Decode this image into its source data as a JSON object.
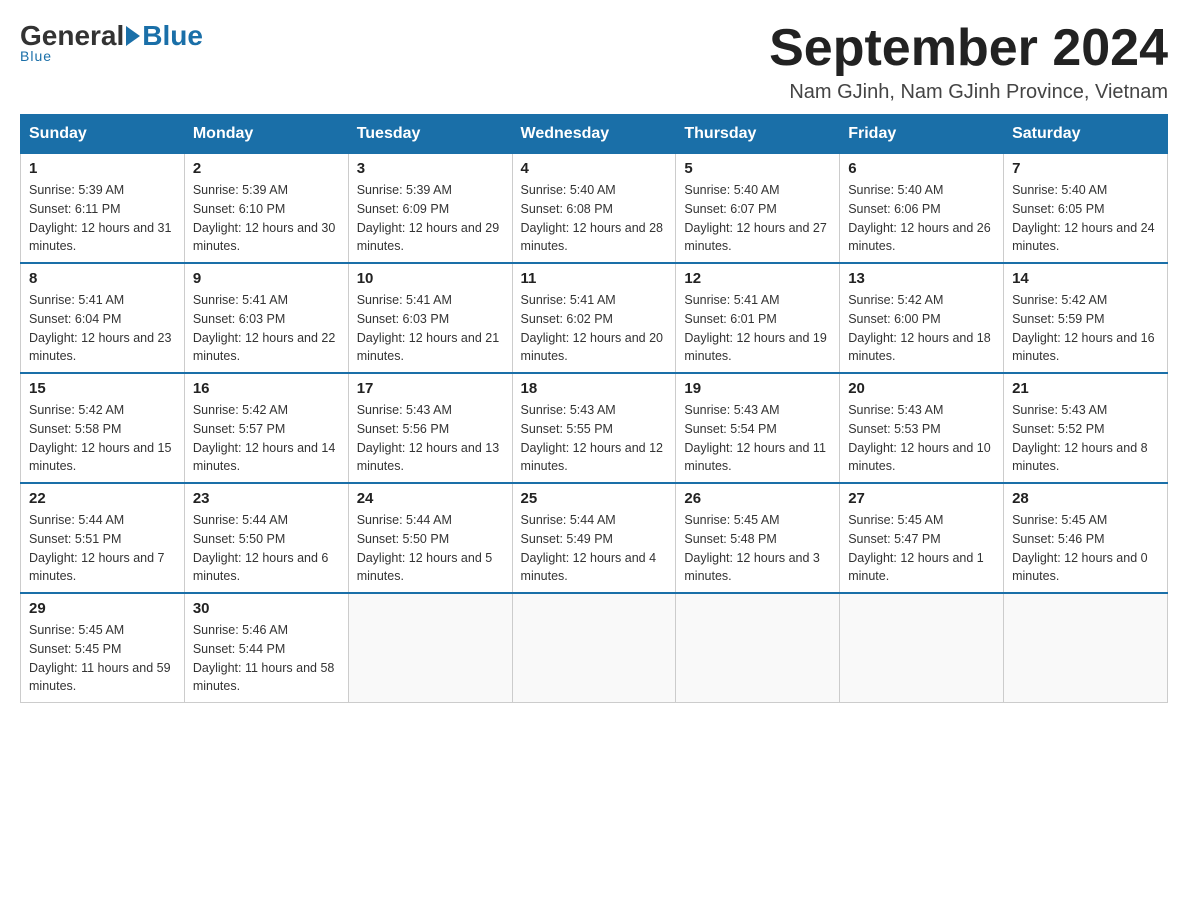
{
  "logo": {
    "general": "General",
    "blue": "Blue",
    "underline": "Blue"
  },
  "header": {
    "month_title": "September 2024",
    "subtitle": "Nam GJinh, Nam GJinh Province, Vietnam"
  },
  "weekdays": [
    "Sunday",
    "Monday",
    "Tuesday",
    "Wednesday",
    "Thursday",
    "Friday",
    "Saturday"
  ],
  "weeks": [
    [
      {
        "day": "1",
        "sunrise": "Sunrise: 5:39 AM",
        "sunset": "Sunset: 6:11 PM",
        "daylight": "Daylight: 12 hours and 31 minutes."
      },
      {
        "day": "2",
        "sunrise": "Sunrise: 5:39 AM",
        "sunset": "Sunset: 6:10 PM",
        "daylight": "Daylight: 12 hours and 30 minutes."
      },
      {
        "day": "3",
        "sunrise": "Sunrise: 5:39 AM",
        "sunset": "Sunset: 6:09 PM",
        "daylight": "Daylight: 12 hours and 29 minutes."
      },
      {
        "day": "4",
        "sunrise": "Sunrise: 5:40 AM",
        "sunset": "Sunset: 6:08 PM",
        "daylight": "Daylight: 12 hours and 28 minutes."
      },
      {
        "day": "5",
        "sunrise": "Sunrise: 5:40 AM",
        "sunset": "Sunset: 6:07 PM",
        "daylight": "Daylight: 12 hours and 27 minutes."
      },
      {
        "day": "6",
        "sunrise": "Sunrise: 5:40 AM",
        "sunset": "Sunset: 6:06 PM",
        "daylight": "Daylight: 12 hours and 26 minutes."
      },
      {
        "day": "7",
        "sunrise": "Sunrise: 5:40 AM",
        "sunset": "Sunset: 6:05 PM",
        "daylight": "Daylight: 12 hours and 24 minutes."
      }
    ],
    [
      {
        "day": "8",
        "sunrise": "Sunrise: 5:41 AM",
        "sunset": "Sunset: 6:04 PM",
        "daylight": "Daylight: 12 hours and 23 minutes."
      },
      {
        "day": "9",
        "sunrise": "Sunrise: 5:41 AM",
        "sunset": "Sunset: 6:03 PM",
        "daylight": "Daylight: 12 hours and 22 minutes."
      },
      {
        "day": "10",
        "sunrise": "Sunrise: 5:41 AM",
        "sunset": "Sunset: 6:03 PM",
        "daylight": "Daylight: 12 hours and 21 minutes."
      },
      {
        "day": "11",
        "sunrise": "Sunrise: 5:41 AM",
        "sunset": "Sunset: 6:02 PM",
        "daylight": "Daylight: 12 hours and 20 minutes."
      },
      {
        "day": "12",
        "sunrise": "Sunrise: 5:41 AM",
        "sunset": "Sunset: 6:01 PM",
        "daylight": "Daylight: 12 hours and 19 minutes."
      },
      {
        "day": "13",
        "sunrise": "Sunrise: 5:42 AM",
        "sunset": "Sunset: 6:00 PM",
        "daylight": "Daylight: 12 hours and 18 minutes."
      },
      {
        "day": "14",
        "sunrise": "Sunrise: 5:42 AM",
        "sunset": "Sunset: 5:59 PM",
        "daylight": "Daylight: 12 hours and 16 minutes."
      }
    ],
    [
      {
        "day": "15",
        "sunrise": "Sunrise: 5:42 AM",
        "sunset": "Sunset: 5:58 PM",
        "daylight": "Daylight: 12 hours and 15 minutes."
      },
      {
        "day": "16",
        "sunrise": "Sunrise: 5:42 AM",
        "sunset": "Sunset: 5:57 PM",
        "daylight": "Daylight: 12 hours and 14 minutes."
      },
      {
        "day": "17",
        "sunrise": "Sunrise: 5:43 AM",
        "sunset": "Sunset: 5:56 PM",
        "daylight": "Daylight: 12 hours and 13 minutes."
      },
      {
        "day": "18",
        "sunrise": "Sunrise: 5:43 AM",
        "sunset": "Sunset: 5:55 PM",
        "daylight": "Daylight: 12 hours and 12 minutes."
      },
      {
        "day": "19",
        "sunrise": "Sunrise: 5:43 AM",
        "sunset": "Sunset: 5:54 PM",
        "daylight": "Daylight: 12 hours and 11 minutes."
      },
      {
        "day": "20",
        "sunrise": "Sunrise: 5:43 AM",
        "sunset": "Sunset: 5:53 PM",
        "daylight": "Daylight: 12 hours and 10 minutes."
      },
      {
        "day": "21",
        "sunrise": "Sunrise: 5:43 AM",
        "sunset": "Sunset: 5:52 PM",
        "daylight": "Daylight: 12 hours and 8 minutes."
      }
    ],
    [
      {
        "day": "22",
        "sunrise": "Sunrise: 5:44 AM",
        "sunset": "Sunset: 5:51 PM",
        "daylight": "Daylight: 12 hours and 7 minutes."
      },
      {
        "day": "23",
        "sunrise": "Sunrise: 5:44 AM",
        "sunset": "Sunset: 5:50 PM",
        "daylight": "Daylight: 12 hours and 6 minutes."
      },
      {
        "day": "24",
        "sunrise": "Sunrise: 5:44 AM",
        "sunset": "Sunset: 5:50 PM",
        "daylight": "Daylight: 12 hours and 5 minutes."
      },
      {
        "day": "25",
        "sunrise": "Sunrise: 5:44 AM",
        "sunset": "Sunset: 5:49 PM",
        "daylight": "Daylight: 12 hours and 4 minutes."
      },
      {
        "day": "26",
        "sunrise": "Sunrise: 5:45 AM",
        "sunset": "Sunset: 5:48 PM",
        "daylight": "Daylight: 12 hours and 3 minutes."
      },
      {
        "day": "27",
        "sunrise": "Sunrise: 5:45 AM",
        "sunset": "Sunset: 5:47 PM",
        "daylight": "Daylight: 12 hours and 1 minute."
      },
      {
        "day": "28",
        "sunrise": "Sunrise: 5:45 AM",
        "sunset": "Sunset: 5:46 PM",
        "daylight": "Daylight: 12 hours and 0 minutes."
      }
    ],
    [
      {
        "day": "29",
        "sunrise": "Sunrise: 5:45 AM",
        "sunset": "Sunset: 5:45 PM",
        "daylight": "Daylight: 11 hours and 59 minutes."
      },
      {
        "day": "30",
        "sunrise": "Sunrise: 5:46 AM",
        "sunset": "Sunset: 5:44 PM",
        "daylight": "Daylight: 11 hours and 58 minutes."
      },
      null,
      null,
      null,
      null,
      null
    ]
  ]
}
